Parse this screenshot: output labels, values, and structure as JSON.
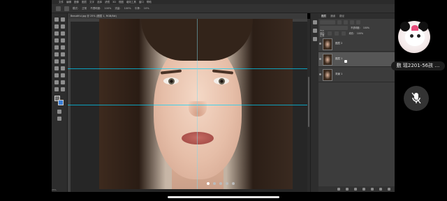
{
  "app": {
    "menu": [
      "文件",
      "编辑",
      "图像",
      "图层",
      "文字",
      "选择",
      "滤镜",
      "3D",
      "视图",
      "增效工具",
      "窗口",
      "帮助"
    ],
    "options": {
      "mode_label": "模式:",
      "mode_value": "正常",
      "opacity_label": "不透明度:",
      "opacity_value": "100%",
      "flow_label": "流量:",
      "flow_value": "100%",
      "smooth_label": "平滑:",
      "smooth_value": "10%"
    },
    "doc_tab": "Beautiful.jpg @ 25% (图层 1, RGB/8#)",
    "status_zoom": "25%"
  },
  "layers_panel": {
    "tabs": [
      "图层",
      "通道",
      "路径"
    ],
    "active_tab": "图层",
    "kind_label": "类型",
    "blend_mode": "正常",
    "opacity_label": "不透明度:",
    "opacity_value": "100%",
    "lock_label": "锁定:",
    "fill_label": "填充:",
    "fill_value": "100%",
    "layers": [
      {
        "name": "图层 2"
      },
      {
        "name": "图层 1"
      },
      {
        "name": "背景 1"
      }
    ]
  },
  "carousel": {
    "pages": 5,
    "active_index": 0
  },
  "overlay": {
    "user_tag": "敷 瑶2201-56孩 …"
  },
  "colors": {
    "guide": "#00d4ff",
    "panel_bg": "#3c3c3c",
    "canvas_bg": "#262626"
  }
}
